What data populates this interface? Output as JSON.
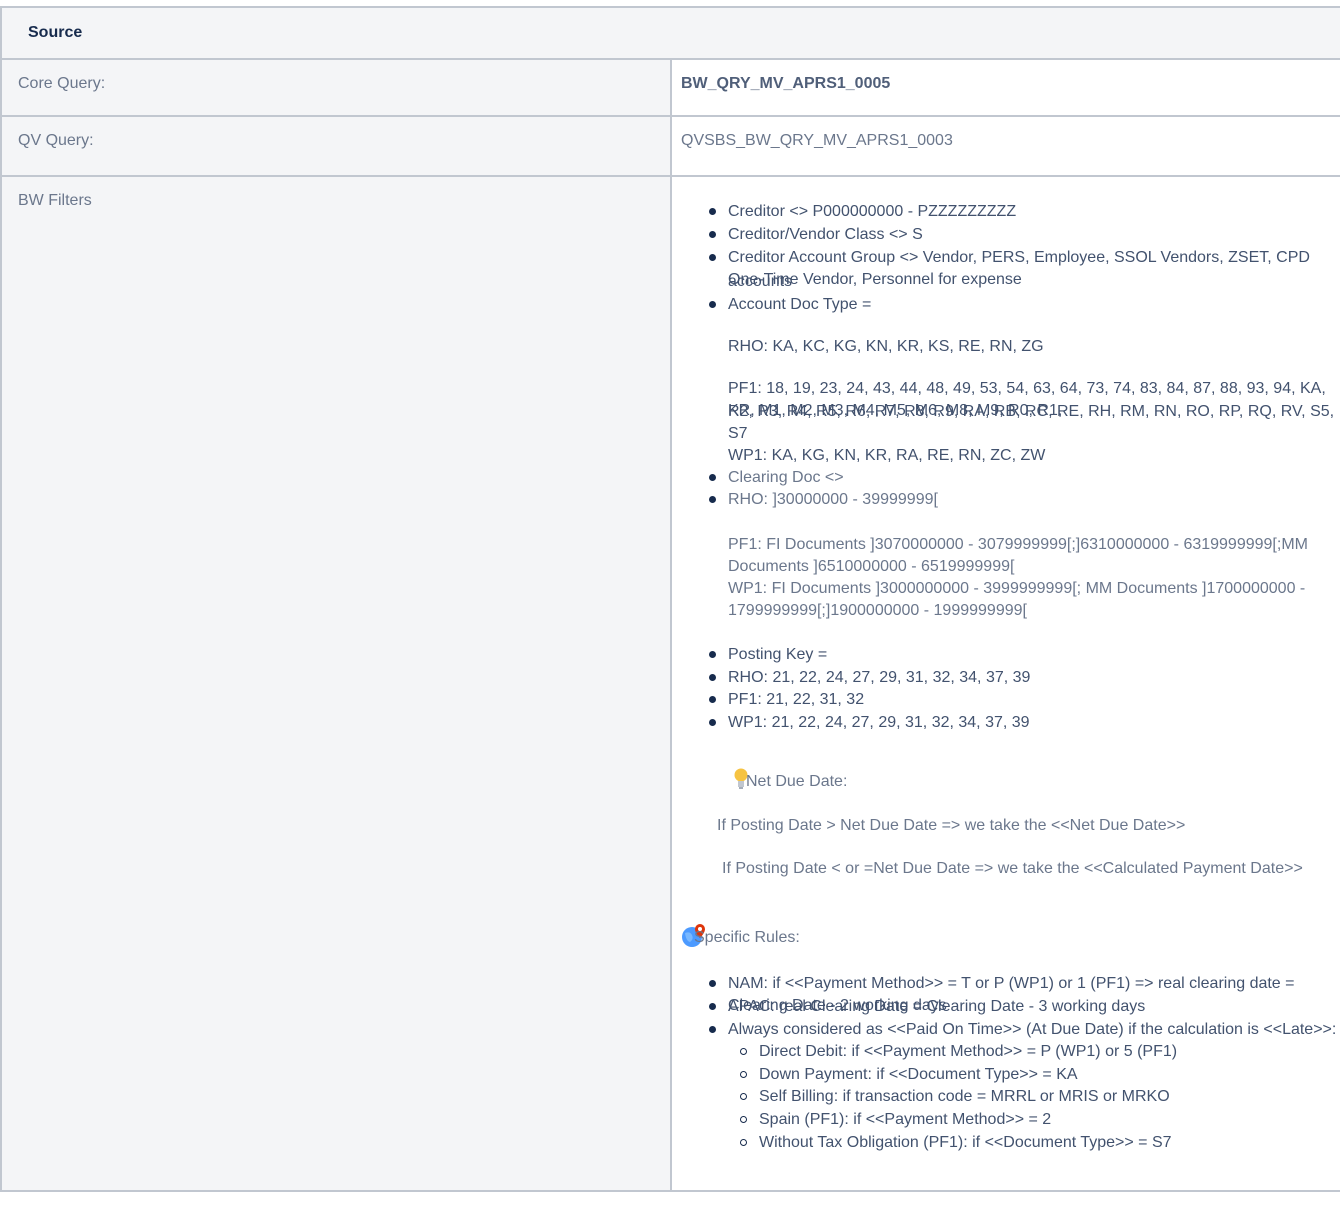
{
  "header": {
    "title": "Source"
  },
  "rows": {
    "core": {
      "label": "Core Query:",
      "value": "BW_QRY_MV_APRS1_0005"
    },
    "qv": {
      "label": "QV Query:",
      "value": "QVSBS_BW_QRY_MV_APRS1_0003"
    },
    "filters": {
      "label": "BW Filters",
      "creditor": "Creditor <> P000000000 - PZZZZZZZZZ",
      "vendor_class": "Creditor/Vendor Class <> S",
      "account_group_1": "Creditor Account Group <> Vendor, PERS, Employee, SSOL Vendors, ZSET, CPD One-Time Vendor, Personnel for expense",
      "account_group_2": "accounts",
      "doc_type": "Account Doc Type =",
      "rho_doc": "RHO: KA, KC, KG, KN, KR, KS, RE, RN, ZG",
      "pf1_doc_1": "PF1: 18, 19, 23, 24, 43, 44, 48, 49, 53, 54, 63, 64, 73, 74, 83, 84, 87, 88, 93, 94, KA, KR, M1, M2, M3, M4, M5, M6, M8, M9, R0, R1,",
      "pf1_doc_2": "R2, R3, R4, R5, R6, R7, R8, R9, RA, RB, RC, RE, RH, RM, RN, RO, RP, RQ, RV, S5, S7",
      "wp1_doc": "WP1: KA, KG, KN, KR, RA, RE, RN, ZC, ZW",
      "clearing_doc": "Clearing Doc <>",
      "rho_clearing": "RHO: ]30000000 - 39999999[",
      "pf1_clearing": "PF1: FI Documents ]3070000000 - 3079999999[;]6310000000 - 6319999999[;MM Documents ]6510000000 - 6519999999[",
      "wp1_clearing": "WP1: FI Documents ]3000000000 - 3999999999[; MM Documents ]1700000000 - 1799999999[;]1900000000 - 1999999999[",
      "posting_key": "Posting Key =",
      "rho_pk": "RHO: 21, 22, 24, 27, 29, 31, 32, 34, 37, 39",
      "pf1_pk": "PF1: 21, 22, 31, 32",
      "wp1_pk": "WP1: 21, 22, 24, 27, 29, 31, 32, 34, 37, 39",
      "net_due_title": "Net Due Date:",
      "net_due_rule1": "If Posting Date > Net Due Date => we take the <<Net Due Date>>",
      "net_due_rule2": "If Posting Date < or =Net Due Date => we take the <<Calculated Payment Date>>",
      "specific_title": "Specific Rules:",
      "rule_nam": "NAM: if <<Payment Method>> = T or P (WP1) or 1 (PF1) => real clearing date = Clearing Date - 2 working days",
      "rule_apac": "APAC: real Clearing Date = Clearing Date - 3 working days",
      "rule_always": "Always considered as <<Paid On Time>> (At Due Date) if the calculation is <<Late>>:",
      "sub_direct": "Direct Debit: if <<Payment Method>> = P (WP1) or 5 (PF1)",
      "sub_down": "Down Payment: if <<Document Type>> = KA",
      "sub_self": "Self Billing: if transaction code = MRRL or MRIS or MRKO",
      "sub_spain": "Spain (PF1): if <<Payment Method>> = 2",
      "sub_tax": "Without Tax Obligation (PF1): if <<Document Type>> = S7"
    }
  },
  "icons": {
    "bulb": "lightbulb-icon",
    "globe": "globe-pin-icon"
  },
  "colors": {
    "border": "#c1c7d0",
    "header_bg": "#f4f5f7",
    "text": "#172b4d",
    "muted": "#6b778c",
    "bulb": "#f6c342",
    "globe": "#4c9aff",
    "pin": "#de350b"
  }
}
